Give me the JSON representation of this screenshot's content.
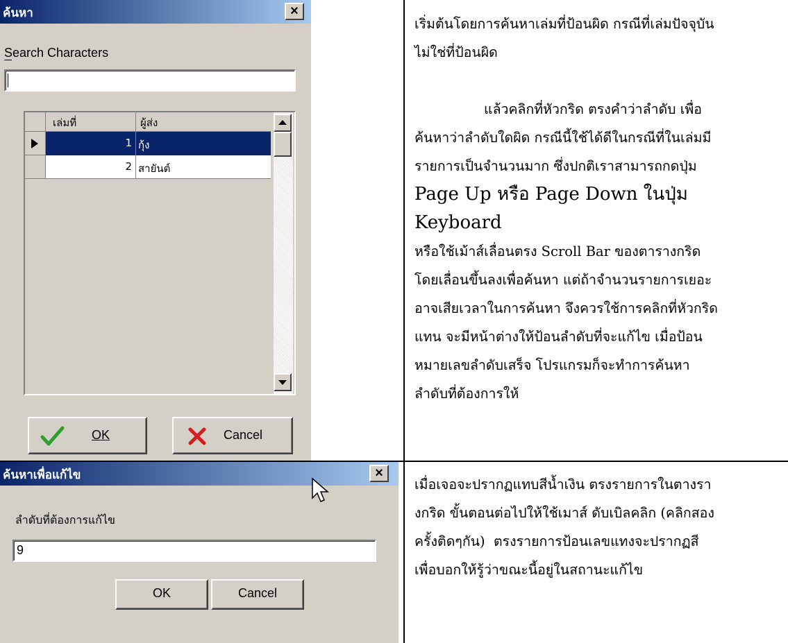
{
  "search_dialog": {
    "title": "ค้นหา",
    "close_glyph": "×",
    "search_label": "Search Characters",
    "search_value": "",
    "grid": {
      "columns": [
        "เล่มที่",
        "ผู้ส่ง"
      ],
      "rows": [
        {
          "no": "1",
          "sender": "กุ้ง",
          "selected": true
        },
        {
          "no": "2",
          "sender": "สายันต์",
          "selected": false
        }
      ]
    },
    "ok_label": "OK",
    "cancel_label": "Cancel"
  },
  "edit_dialog": {
    "title": "ค้นหาเพื่อแก้ไข",
    "close_glyph": "×",
    "field_label": "ลำดับที่ต้องการแก้ไข",
    "field_value": "9",
    "ok_label": "OK",
    "cancel_label": "Cancel"
  },
  "right_text_top": {
    "p1_line1": "เริ่มต้นโดยการค้นหาเล่มที่ป้อนผิด กรณีที่เล่มปัจจุบัน",
    "p1_line2": "ไม่ใช่ที่ป้อนผิด",
    "p2_line1": "แล้วคลิกที่หัวกริด ตรงคำว่าลำดับ เพื่อ",
    "p2_line2": "ค้นหาว่าลำดับใดผิด กรณีนี้ใช้ได้ดีในกรณีที่ในเล่มมี",
    "p2_line3": "รายการเป็นจำนวนมาก ซึ่งปกติเราสามารถกดปุ่ม",
    "p2_line4": "Page Up หรือ Page Down ในปุ่ม Keyboard",
    "p2_line5": "หรือใช้เม้าส์เลื่อนตรง Scroll Bar ของตารางกริด",
    "p2_line6": "โดยเลื่อนขึ้นลงเพื่อค้นหา แต่ถ้าจำนวนรายการเยอะ",
    "p2_line7": "อาจเสียเวลาในการค้นหา จึงควรใช้การคลิกที่หัวกริด",
    "p2_line8": "แทน จะมีหน้าต่างให้ป้อนลำดับที่จะแก้ไข เมื่อป้อน",
    "p2_line9": "หมายเลขลำดับเสร็จ โปรแกรมก็จะทำการค้นหา",
    "p2_line10": "ลำดับที่ต้องการให้"
  },
  "right_text_bottom": {
    "line1": "เมื่อเจอจะปรากฏแทบสีน้ำเงิน ตรงรายการในตางรา",
    "line2": "งกริด ขั้นตอนต่อไปให้ใช้เมาส์ ดับเบิลคลิก (คลิกสอง",
    "line3": "ครั้งติดๆกัน)  ตรงรายการป้อนเลขแทงจะปรากฏสี",
    "line4": "เพื่อบอกให้รู้ว่าขณะนี้อยู่ในสถานะแก้ไข"
  },
  "colors": {
    "titlebar_start": "#0a246a",
    "titlebar_end": "#a6caf0",
    "selection": "#0a246a",
    "checkmark": "#2e9e2e",
    "cancel_x": "#d21e1e",
    "dialog_face": "#d4d0c8"
  },
  "icons": [
    "close-icon",
    "checkmark-icon",
    "cancel-x-icon",
    "row-indicator-icon",
    "scroll-up-icon",
    "scroll-down-icon",
    "mouse-cursor-icon"
  ]
}
